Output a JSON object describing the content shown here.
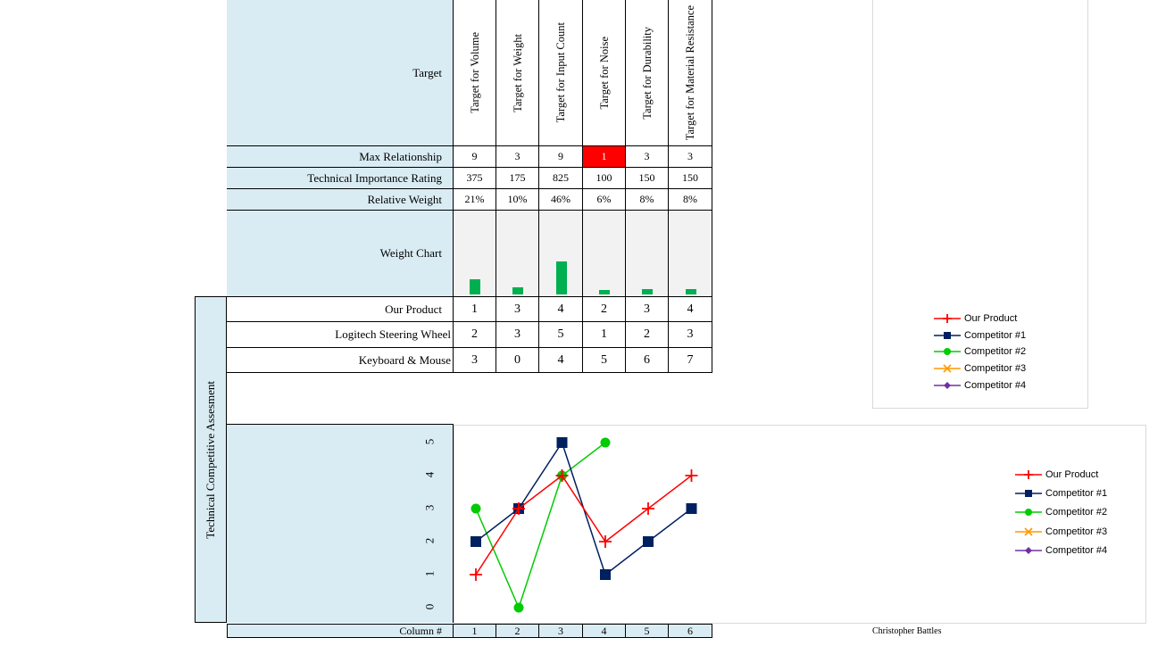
{
  "header": {
    "target_label": "Target",
    "targets": [
      "Target for Volume",
      "Target for Weight",
      "Target for Input Count",
      "Target for Noise",
      "Target for Durability",
      "Target for Material Resistance"
    ]
  },
  "rows": {
    "max_relationship": {
      "label": "Max Relationship",
      "values": [
        "9",
        "3",
        "9",
        "1",
        "3",
        "3"
      ]
    },
    "tech_importance": {
      "label": "Technical Importance Rating",
      "values": [
        "375",
        "175",
        "825",
        "100",
        "150",
        "150"
      ]
    },
    "relative_weight": {
      "label": "Relative Weight",
      "values": [
        "21%",
        "10%",
        "46%",
        "6%",
        "8%",
        "8%"
      ],
      "fractions": [
        0.21,
        0.1,
        0.46,
        0.06,
        0.08,
        0.08
      ]
    },
    "weight_chart_label": "Weight Chart"
  },
  "assessment": {
    "side_label": "Technical Competitive Assesment",
    "products": [
      {
        "label": "Our Product",
        "values": [
          "1",
          "3",
          "4",
          "2",
          "3",
          "4"
        ]
      },
      {
        "label": "Logitech Steering Wheel",
        "values": [
          "2",
          "3",
          "5",
          "1",
          "2",
          "3"
        ]
      },
      {
        "label": "Keyboard & Mouse",
        "values": [
          "3",
          "0",
          "4",
          "5",
          "6",
          "7"
        ]
      }
    ]
  },
  "legend_items": [
    "Our Product",
    "Competitor #1",
    "Competitor #2",
    "Competitor #3",
    "Competitor #4"
  ],
  "colors": {
    "our_product": "#ff0000",
    "competitor1": "#002060",
    "competitor2": "#00cc00",
    "competitor3": "#ff9900",
    "competitor4": "#7030a0",
    "highlight": "#ff0000",
    "weight_bar": "#00b050"
  },
  "chart_data": {
    "type": "line",
    "x": [
      1,
      2,
      3,
      4,
      5,
      6
    ],
    "ylim": [
      0,
      5
    ],
    "yticks": [
      "0",
      "1",
      "2",
      "3",
      "4",
      "5"
    ],
    "xlabel": "Column #",
    "series": [
      {
        "name": "Our Product",
        "values": [
          1,
          3,
          4,
          2,
          3,
          4
        ],
        "marker": "plus"
      },
      {
        "name": "Competitor #1",
        "values": [
          2,
          3,
          5,
          1,
          2,
          3
        ],
        "marker": "square"
      },
      {
        "name": "Competitor #2",
        "values": [
          3,
          0,
          4,
          5,
          null,
          null
        ],
        "marker": "circle"
      },
      {
        "name": "Competitor #3",
        "values": [],
        "marker": "x"
      },
      {
        "name": "Competitor #4",
        "values": [],
        "marker": "diamond"
      }
    ]
  },
  "footer": {
    "author": "Christopher Battles"
  }
}
